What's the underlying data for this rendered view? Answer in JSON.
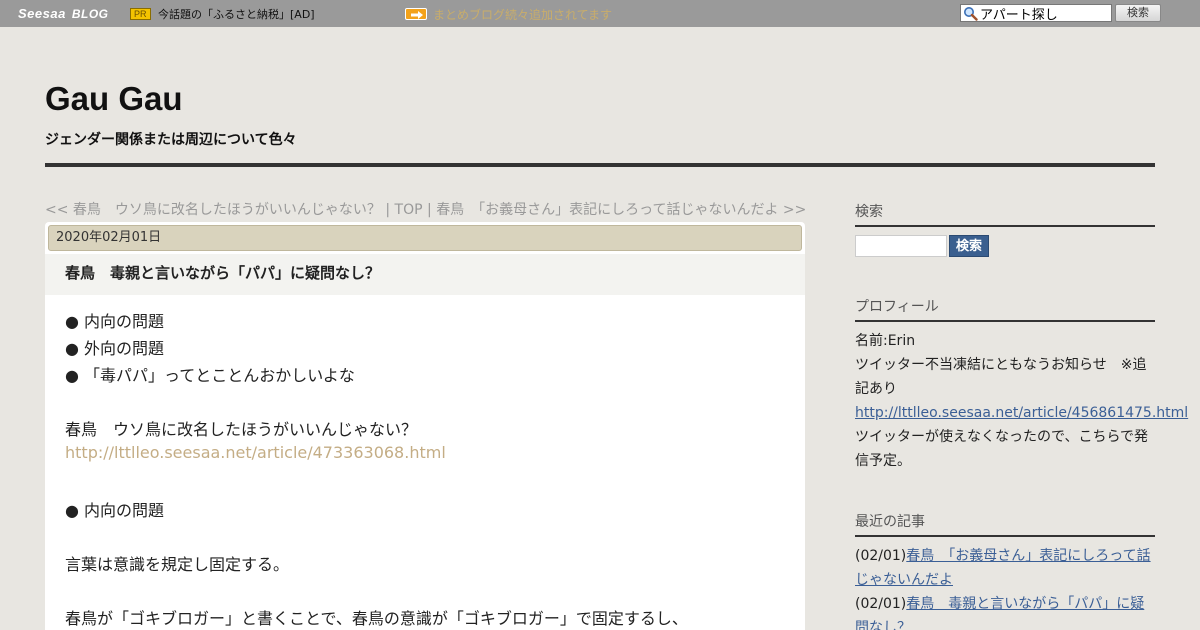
{
  "topbar": {
    "logo": "Seesaa",
    "logo_blog": "BLOG",
    "pr_badge": "PR",
    "pr_text": "今話題の「ふるさと納税」[AD]",
    "news_text": "まとめブログ続々追加されてます",
    "search_value": "アパート探し",
    "search_button": "検索"
  },
  "header": {
    "title": "Gau Gau",
    "description": "ジェンダー関係または周辺について色々"
  },
  "nav": {
    "prev": "<< 春鳥　ウソ鳥に改名したほうがいいんじゃない？",
    "sep1": " | ",
    "top": "TOP",
    "sep2": " | ",
    "next": "春鳥　「お義母さん」表記にしろって話じゃないんだよ >>"
  },
  "article": {
    "date": "2020年02月01日",
    "title": "春鳥　毒親と言いながら「パパ」に疑問なし？",
    "lines": [
      "● 内向の問題",
      "● 外向の問題",
      "● 「毒パパ」ってとことんおかしいよな",
      "春鳥　ウソ鳥に改名したほうがいいんじゃない？",
      "http://lttlleo.seesaa.net/article/473363068.html",
      "● 内向の問題",
      "言葉は意識を規定し固定する。",
      "春鳥が「ゴキブロガー」と書くことで、春鳥の意識が「ゴキブロガー」で固定するし、"
    ]
  },
  "sidebar": {
    "search_heading": "検索",
    "search_button": "検索",
    "profile_heading": "プロフィール",
    "profile_name": "名前:Erin",
    "profile_notice": "ツイッター不当凍結にともなうお知らせ　※追記あり",
    "profile_link": "http://lttlleo.seesaa.net/article/456861475.html",
    "profile_note": "ツイッターが使えなくなったので、こちらで発信予定。",
    "recent_heading": "最近の記事",
    "recent": [
      {
        "date": "(02/01)",
        "title": "春鳥　「お義母さん」表記にしろって話じゃないんだよ"
      },
      {
        "date": "(02/01)",
        "title": "春鳥　毒親と言いながら「パパ」に疑問なし？"
      }
    ]
  }
}
